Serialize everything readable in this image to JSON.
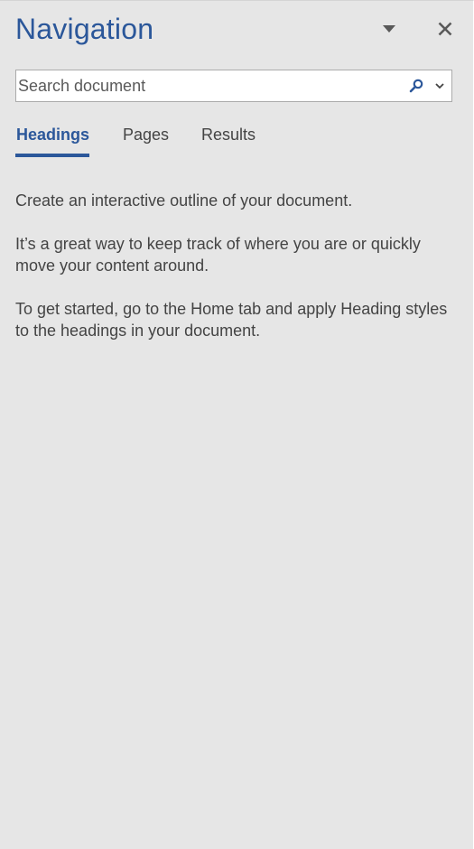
{
  "pane": {
    "title": "Navigation"
  },
  "search": {
    "placeholder": "Search document",
    "value": ""
  },
  "tabs": [
    {
      "label": "Headings",
      "active": true
    },
    {
      "label": "Pages",
      "active": false
    },
    {
      "label": "Results",
      "active": false
    }
  ],
  "content": {
    "line1": "Create an interactive outline of your document.",
    "line2": "It’s a great way to keep track of where you are or quickly move your content around.",
    "line3": "To get started, go to the Home tab and apply Heading styles to the headings in your document."
  },
  "icons": {
    "options": "dropdown-triangle-icon",
    "close": "close-icon",
    "search": "magnifier-icon",
    "search_options": "chevron-down-icon"
  },
  "colors": {
    "accent": "#2b579a",
    "pane_background": "#e6e6e6",
    "text": "#444444"
  }
}
